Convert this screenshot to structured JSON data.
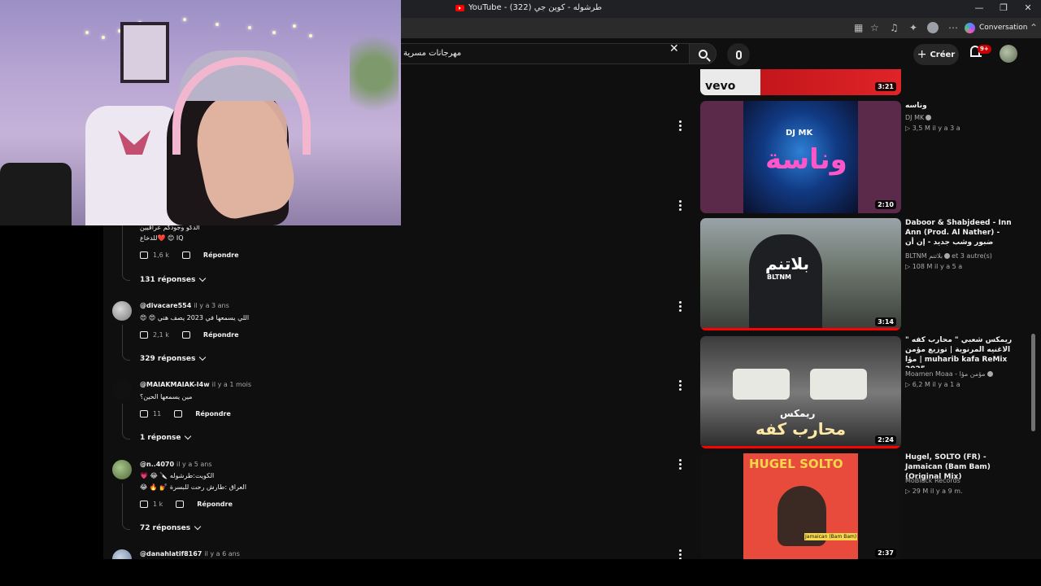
{
  "window": {
    "tab_title": "YouTube - طرشوله - كوين جي (322)",
    "controls": [
      "—",
      "❐",
      "✕"
    ],
    "conversation_label": "Conversation"
  },
  "header": {
    "search_value": "مهرجانات مسرية",
    "create_label": "Créer",
    "notification_count": "9+"
  },
  "comments": [
    {
      "text_lines": [
        "الدكو وجودكم عراقيين",
        "للدخاع❤️ 😊 IQ"
      ],
      "likes": "1,6 k",
      "reply_label": "Répondre",
      "replies_label": "131 réponses"
    },
    {
      "author": "@divacare554",
      "time": "il y a 3 ans",
      "text_lines": [
        "😍 😍 اللي يسمعها في 2023 يصف هني"
      ],
      "likes": "2,1 k",
      "reply_label": "Répondre",
      "replies_label": "329 réponses"
    },
    {
      "author": "@MAIAKMAIAK-I4w",
      "time": "il y a 1 mois",
      "text_lines": [
        "مين يسمعها الحين؟"
      ],
      "likes": "11",
      "reply_label": "Répondre",
      "replies_label": "1 réponse"
    },
    {
      "author": "@n..4070",
      "time": "il y a 5 ans",
      "text_lines": [
        "💗 😂 🔪 الكويت:طرشوله",
        "😂 🔥 💅 العراق :طارش رحت للبسرة"
      ],
      "likes": "1 k",
      "reply_label": "Répondre",
      "replies_label": "72 réponses"
    },
    {
      "author": "@danahlatif8167",
      "time": "il y a 6 ans"
    }
  ],
  "videos": [
    {
      "title": "وناسه",
      "channel": "DJ MK",
      "meta": "3,5 M  il y a 3 a",
      "duration": "3:21",
      "thumb_text": "vevo"
    },
    {
      "title": "",
      "channel": "",
      "meta": "",
      "duration": "2:10",
      "thumb_text": "DJ MK",
      "thumb_text_2": "وناسة"
    },
    {
      "title": "Daboor & Shabjdeed - Inn Ann (Prod. Al Nather) - ضبور وشب جديد - إن أن",
      "channel": "BLTNM بلاتنم",
      "channel_extra": "et 3 autre(s)",
      "meta": "108 M  il y a 5 a",
      "duration": "3:14",
      "thumb_text": "بلاتنم",
      "thumb_text_2": "BLTNM"
    },
    {
      "title": "ريمكس شعبي \" محارب كفه \" الاغنيه المرنوية | توزيع مؤمن مؤا | muharib kafa ReMix 2025",
      "channel": "Moamen Moaa - مؤمن مؤا",
      "meta": "6,2 M  il y a 1 a",
      "duration": "2:24",
      "thumb_text": "ريمكس",
      "thumb_text_2": "محارب كفه"
    },
    {
      "title": "Hugel, SOLTO (FR) - Jamaican (Bam Bam) (Original Mix)",
      "channel": "MoBlack Records",
      "meta": "29 M  il y a 9 m.",
      "duration": "2:37",
      "thumb_text": "HUGEL SOLTO",
      "thumb_text_2": "Jamaican (Bam Bam)"
    }
  ],
  "colors": {
    "background": "#0f0f0f",
    "accent": "#ff0000",
    "text": "#f1f1f1",
    "muted": "#aaaaaa"
  }
}
